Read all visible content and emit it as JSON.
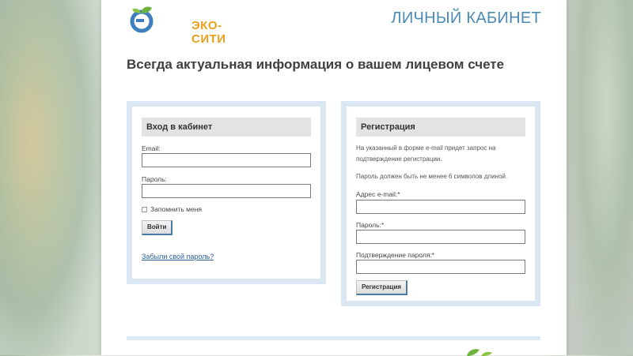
{
  "brand": {
    "name": "ЭКО-СИТИ",
    "colors": {
      "green": "#6db33f",
      "blue": "#3f7fbf",
      "orange": "#e8a01a"
    }
  },
  "header": {
    "title": "ЛИЧНЫЙ КАБИНЕТ"
  },
  "headline": "Всегда актуальная информация о вашем лицевом счете",
  "login": {
    "title": "Вход в кабинет",
    "email_label": "Email:",
    "email_value": "",
    "password_label": "Пароль:",
    "password_value": "",
    "remember_label": "Запомнить меня",
    "remember_checked": false,
    "submit_label": "Войти",
    "forgot_link": "Забыли свой пароль?"
  },
  "registration": {
    "title": "Регистрация",
    "note1": "На указанный в форме e-mail придет запрос на подтверждение регистрации.",
    "note2": "Пароль должен быть не менее 6 символов длиной.",
    "email_label": "Адрес e-mail:*",
    "email_value": "",
    "password_label": "Пароль:*",
    "password_value": "",
    "confirm_label": "Подтверждение пароля:*",
    "confirm_value": "",
    "submit_label": "Регистрация"
  }
}
